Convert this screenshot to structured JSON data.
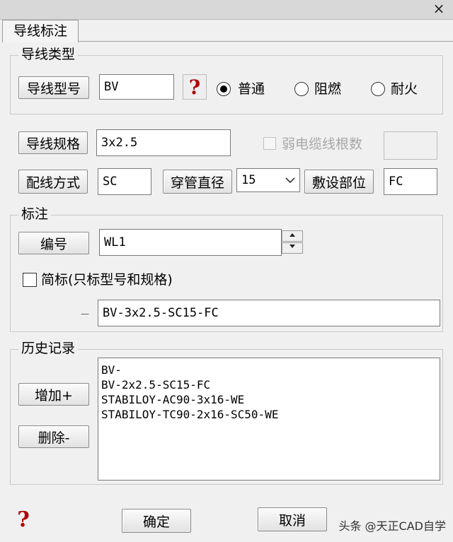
{
  "window": {
    "tab_label": "导线标注",
    "close_glyph": "×"
  },
  "wire_type": {
    "legend": "导线类型",
    "model_button": "导线型号",
    "model_value": "BV",
    "help_glyph": "?",
    "radios": [
      {
        "label": "普通",
        "checked": true
      },
      {
        "label": "阻燃",
        "checked": false
      },
      {
        "label": "耐火",
        "checked": false
      }
    ]
  },
  "spec": {
    "spec_button": "导线规格",
    "spec_value": "3x2.5",
    "weak_cable_label": "弱电缆线根数",
    "weak_cable_value": "",
    "method_button": "配线方式",
    "method_value": "SC",
    "pipe_button": "穿管直径",
    "pipe_value": "15",
    "lay_button": "敷设部位",
    "lay_value": "FC"
  },
  "annotation": {
    "legend": "标注",
    "number_button": "编号",
    "number_value": "WL1",
    "simple_label": "简标(只标型号和规格)",
    "simple_checked": false,
    "preview_dash": "—",
    "preview_value": "BV-3x2.5-SC15-FC"
  },
  "history": {
    "legend": "历史记录",
    "add_button": "增加+",
    "delete_button": "删除-",
    "items": [
      "BV-",
      "BV-2x2.5-SC15-FC",
      "STABILOY-AC90-3x16-WE",
      "STABILOY-TC90-2x16-SC50-WE"
    ]
  },
  "footer": {
    "help_glyph": "?",
    "ok_button": "确定",
    "cancel_button": "取消",
    "watermark": "头条 @天正CAD自学"
  }
}
